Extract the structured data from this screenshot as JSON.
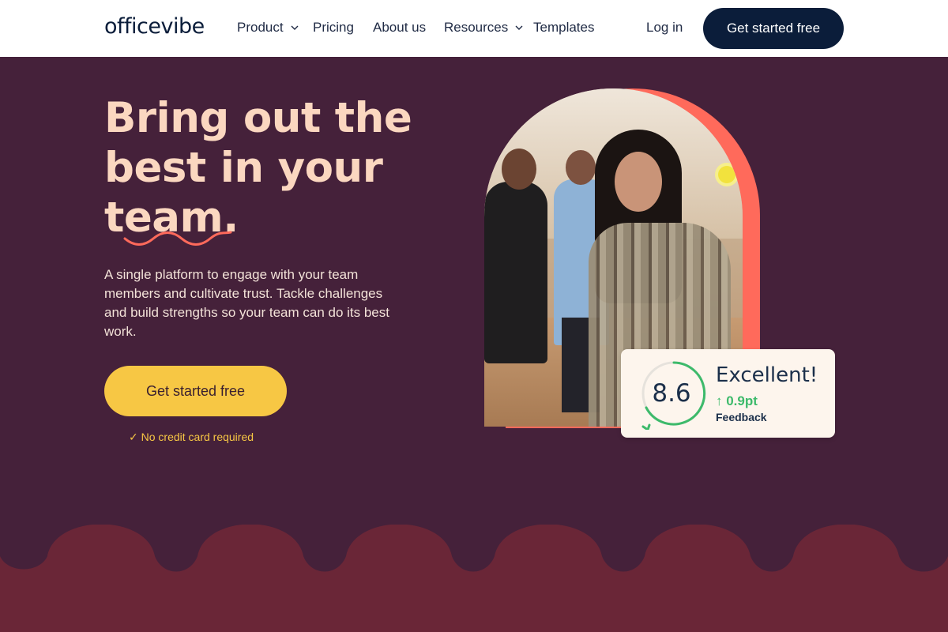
{
  "nav": {
    "logo": "officevibe",
    "items": [
      {
        "label": "Product",
        "has_dropdown": true
      },
      {
        "label": "Pricing",
        "has_dropdown": false
      },
      {
        "label": "About us",
        "has_dropdown": false
      },
      {
        "label": "Resources",
        "has_dropdown": true
      },
      {
        "label": "Templates",
        "has_dropdown": false
      }
    ],
    "login": "Log in",
    "cta": "Get started free"
  },
  "hero": {
    "headline_line1": "Bring out the",
    "headline_line2": "best in your",
    "headline_line3": "team.",
    "subtext": "A single platform to engage with your team members and cultivate trust. Tackle challenges and build strengths so your team can do its best work.",
    "cta": "Get started free",
    "no_cc": "✓ No credit card required"
  },
  "score_card": {
    "score": "8.6",
    "rating": "Excellent!",
    "delta": "↑ 0.9pt",
    "label": "Feedback"
  },
  "colors": {
    "nav_bg": "#ffffff",
    "brand_navy": "#0b1d3a",
    "hero_bg": "#45213a",
    "headline": "#fbd7c0",
    "cta_yellow": "#f7c744",
    "accent_coral": "#ff6a5b",
    "positive_green": "#3dba6b",
    "wave_bg": "#6a2637"
  }
}
